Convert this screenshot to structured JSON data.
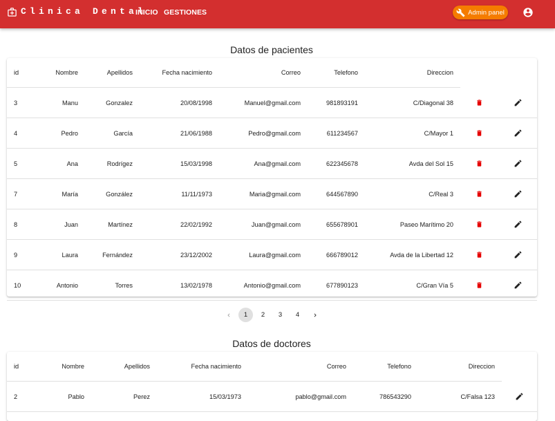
{
  "app": {
    "brand": "Clinica Dental",
    "nav": [
      {
        "label": "INICIO"
      },
      {
        "label": "GESTIONES"
      }
    ],
    "admin_button": "Admin panel",
    "colors": {
      "primary": "#d32f2f",
      "accent": "#f57c00",
      "delete": "#e60000"
    }
  },
  "patients": {
    "title": "Datos de pacientes",
    "headers": [
      "id",
      "Nombre",
      "Apellidos",
      "Fecha nacimiento",
      "Correo",
      "Telefono",
      "Direccion"
    ],
    "rows": [
      {
        "id": "3",
        "nombre": "Manu",
        "apellidos": "Gonzalez",
        "fecha": "20/08/1998",
        "correo": "Manuel@gmail.com",
        "telefono": "981893191",
        "direccion": "C/Diagonal 38"
      },
      {
        "id": "4",
        "nombre": "Pedro",
        "apellidos": "García",
        "fecha": "21/06/1988",
        "correo": "Pedro@gmail.com",
        "telefono": "611234567",
        "direccion": "C/Mayor 1"
      },
      {
        "id": "5",
        "nombre": "Ana",
        "apellidos": "Rodrígez",
        "fecha": "15/03/1998",
        "correo": "Ana@gmail.com",
        "telefono": "622345678",
        "direccion": "Avda del Sol 15"
      },
      {
        "id": "7",
        "nombre": "María",
        "apellidos": "González",
        "fecha": "11/11/1973",
        "correo": "Maria@gmail.com",
        "telefono": "644567890",
        "direccion": "C/Real 3"
      },
      {
        "id": "8",
        "nombre": "Juan",
        "apellidos": "Martínez",
        "fecha": "22/02/1992",
        "correo": "Juan@gmail.com",
        "telefono": "655678901",
        "direccion": "Paseo Marítimo 20"
      },
      {
        "id": "9",
        "nombre": "Laura",
        "apellidos": "Fernández",
        "fecha": "23/12/2002",
        "correo": "Laura@gmail.com",
        "telefono": "666789012",
        "direccion": "Avda de la Libertad 12"
      },
      {
        "id": "10",
        "nombre": "Antonio",
        "apellidos": "Torres",
        "fecha": "13/02/1978",
        "correo": "Antonio@gmail.com",
        "telefono": "677890123",
        "direccion": "C/Gran Vía 5"
      }
    ]
  },
  "pagination": {
    "pages": [
      "1",
      "2",
      "3",
      "4"
    ],
    "current": "1",
    "prev_icon": "chevron-left-icon",
    "next_icon": "chevron-right-icon"
  },
  "doctors": {
    "title": "Datos de doctores",
    "headers": [
      "id",
      "Nombre",
      "Apellidos",
      "Fecha nacimiento",
      "Correo",
      "Telefono",
      "Direccion"
    ],
    "rows": [
      {
        "id": "2",
        "nombre": "Pablo",
        "apellidos": "Perez",
        "fecha": "15/03/1973",
        "correo": "pablo@gmail.com",
        "telefono": "786543290",
        "direccion": "C/Falsa 123"
      }
    ]
  }
}
